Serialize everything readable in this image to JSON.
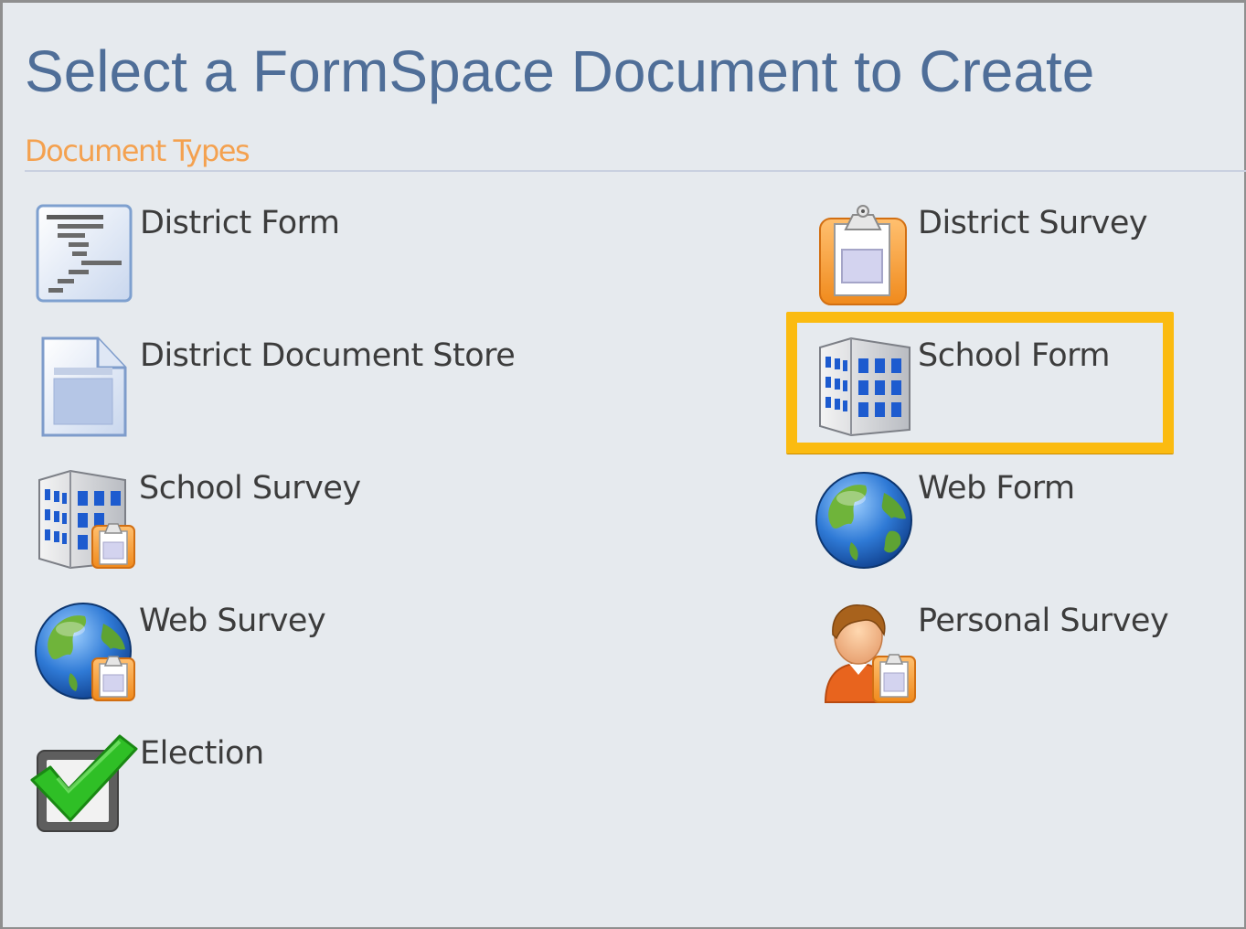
{
  "page": {
    "title": "Select a FormSpace Document to Create",
    "section_title": "Document Types"
  },
  "colors": {
    "title": "#4f6e98",
    "section_title": "#f4a14f",
    "highlight": "#fbbb10",
    "background": "#e6eaee"
  },
  "document_types": {
    "district_form": {
      "label": "District Form",
      "icon": "district-form-icon"
    },
    "district_survey": {
      "label": "District Survey",
      "icon": "clipboard-icon"
    },
    "district_document_store": {
      "label": "District Document Store",
      "icon": "document-icon"
    },
    "school_form": {
      "label": "School Form",
      "icon": "building-icon",
      "highlighted": true
    },
    "school_survey": {
      "label": "School Survey",
      "icon": "building-clipboard-icon"
    },
    "web_form": {
      "label": "Web Form",
      "icon": "globe-icon"
    },
    "web_survey": {
      "label": "Web Survey",
      "icon": "globe-clipboard-icon"
    },
    "personal_survey": {
      "label": "Personal Survey",
      "icon": "person-clipboard-icon"
    },
    "election": {
      "label": "Election",
      "icon": "checkbox-checkmark-icon"
    }
  }
}
